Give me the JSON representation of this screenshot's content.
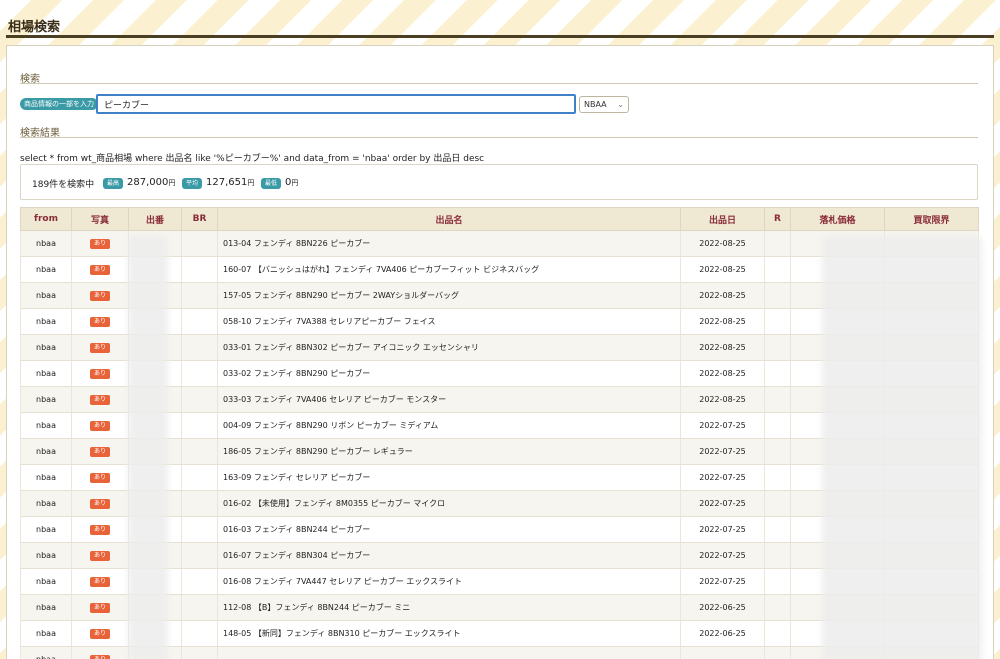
{
  "page": {
    "title": "相場検索"
  },
  "search": {
    "section_label": "検索",
    "input_label": "商品情報の一部を入力",
    "query_value": "ピーカブー",
    "source_value": "NBAA"
  },
  "results": {
    "section_label": "検索結果",
    "query_text": "select * from wt_商品相場 where 出品名 like '%ピーカブー%' and data_from = 'nbaa' order by 出品日 desc",
    "count_text": "189件を検索中",
    "stats": {
      "max_label": "最高",
      "max_value": "287,000",
      "avg_label": "平均",
      "avg_value": "127,651",
      "min_label": "最低",
      "min_value": "0",
      "currency": "円"
    }
  },
  "table": {
    "columns": [
      "from",
      "写真",
      "出番",
      "BR",
      "出品名",
      "出品日",
      "R",
      "落札価格",
      "買取限界"
    ],
    "rows": [
      {
        "from": "nbaa",
        "photo": "あり",
        "name": "013-04 フェンディ 8BN226 ピーカブー",
        "date": "2022-08-25"
      },
      {
        "from": "nbaa",
        "photo": "あり",
        "name": "160-07 【バニッシュはがれ】フェンディ 7VA406 ピーカブーフィット ビジネスバッグ",
        "date": "2022-08-25"
      },
      {
        "from": "nbaa",
        "photo": "あり",
        "name": "157-05 フェンディ 8BN290 ピーカブー 2WAYショルダーバッグ",
        "date": "2022-08-25"
      },
      {
        "from": "nbaa",
        "photo": "あり",
        "name": "058-10 フェンディ 7VA388 セレリアピーカブー フェイス",
        "date": "2022-08-25"
      },
      {
        "from": "nbaa",
        "photo": "あり",
        "name": "033-01 フェンディ 8BN302 ピーカブー アイコニック エッセンシャリ",
        "date": "2022-08-25"
      },
      {
        "from": "nbaa",
        "photo": "あり",
        "name": "033-02 フェンディ 8BN290 ピーカブー",
        "date": "2022-08-25"
      },
      {
        "from": "nbaa",
        "photo": "あり",
        "name": "033-03 フェンディ 7VA406 セレリア ピーカブー モンスター",
        "date": "2022-08-25"
      },
      {
        "from": "nbaa",
        "photo": "あり",
        "name": "004-09 フェンディ 8BN290 リボン ピーカブー ミディアム",
        "date": "2022-07-25"
      },
      {
        "from": "nbaa",
        "photo": "あり",
        "name": "186-05 フェンディ 8BN290 ピーカブー レギュラー",
        "date": "2022-07-25"
      },
      {
        "from": "nbaa",
        "photo": "あり",
        "name": "163-09 フェンディ セレリア ピーカブー",
        "date": "2022-07-25"
      },
      {
        "from": "nbaa",
        "photo": "あり",
        "name": "016-02 【未使用】フェンディ 8M0355 ピーカブー マイクロ",
        "date": "2022-07-25"
      },
      {
        "from": "nbaa",
        "photo": "あり",
        "name": "016-03 フェンディ 8BN244 ピーカブー",
        "date": "2022-07-25"
      },
      {
        "from": "nbaa",
        "photo": "あり",
        "name": "016-07 フェンディ 8BN304 ピーカブー",
        "date": "2022-07-25"
      },
      {
        "from": "nbaa",
        "photo": "あり",
        "name": "016-08 フェンディ 7VA447 セレリア ピーカブー エックスライト",
        "date": "2022-07-25"
      },
      {
        "from": "nbaa",
        "photo": "あり",
        "name": "112-08 【B】フェンディ 8BN244 ピーカブー ミニ",
        "date": "2022-06-25"
      },
      {
        "from": "nbaa",
        "photo": "あり",
        "name": "148-05 【新同】フェンディ 8BN310 ピーカブー エックスライト",
        "date": "2022-06-25"
      },
      {
        "from": "nbaa",
        "photo": "あり",
        "name": "",
        "date": ""
      }
    ]
  }
}
